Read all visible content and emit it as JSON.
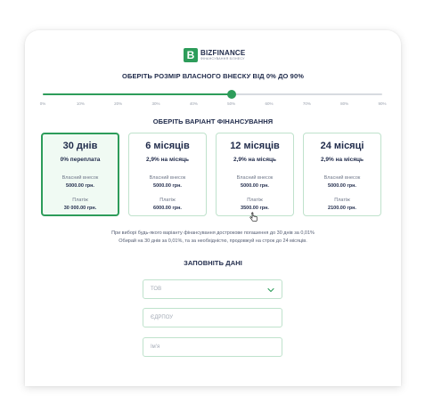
{
  "logo": {
    "name": "BIZFINANCE",
    "tagline": "ФІНАНСУВАННЯ БІЗНЕСУ",
    "mark": "B"
  },
  "contribution": {
    "heading": "ОБЕРІТЬ РОЗМІР ВЛАСНОГО ВНЕСКУ ВІД 0% ДО 90%",
    "value_percent": 50,
    "ticks": [
      "0%",
      "10%",
      "20%",
      "30%",
      "40%",
      "50%",
      "60%",
      "70%",
      "80%",
      "90%"
    ]
  },
  "financing": {
    "heading": "ОБЕРІТЬ ВАРІАНТ ФІНАНСУВАННЯ",
    "selected_index": 0,
    "hovered_index": 2,
    "plans": [
      {
        "title": "30 днів",
        "rate": "0% переплата",
        "own_label": "Власний внесок",
        "own_value": "5000.00 грн.",
        "payment_label": "Платіж",
        "payment_value": "30 000.00 грн."
      },
      {
        "title": "6 місяців",
        "rate": "2,9% на місяць",
        "own_label": "Власний внесок",
        "own_value": "5000.00 грн.",
        "payment_label": "Платіж",
        "payment_value": "6000.00 грн."
      },
      {
        "title": "12 місяців",
        "rate": "2,9% на місяць",
        "own_label": "Власний внесок",
        "own_value": "5000.00 грн.",
        "payment_label": "Платіж",
        "payment_value": "3500.00 грн."
      },
      {
        "title": "24 місяці",
        "rate": "2,9% на місяць",
        "own_label": "Власний внесок",
        "own_value": "5000.00 грн.",
        "payment_label": "Платіж",
        "payment_value": "2100.00 грн."
      }
    ]
  },
  "note": {
    "line1": "При виборі будь-якого варіанту фінансування дострокове погашення до 30 днів за 0,01%",
    "line2": "Обирай на 30 днів за 0,01%, та за необхідністю, продовжуй на строк до 24 місяців."
  },
  "form": {
    "heading": "ЗАПОВНІТЬ ДАНІ",
    "type_select": "ТОВ",
    "edrpou_placeholder": "ЄДРПОУ",
    "name_placeholder": "Ім'я"
  },
  "colors": {
    "accent": "#2d9c5a",
    "text": "#1f2a4a",
    "border": "#bfe2cc"
  },
  "icons": {
    "logo": "bizfinance-logo-icon",
    "chevron": "chevron-down-icon",
    "cursor": "hand-pointer-icon"
  }
}
